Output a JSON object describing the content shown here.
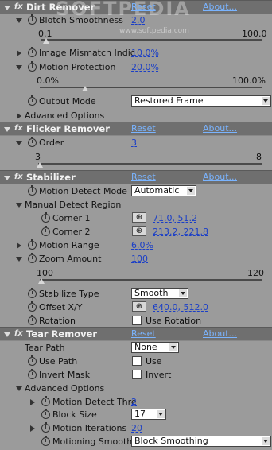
{
  "watermark": {
    "text": "SOFTPEDIA",
    "sub": "www.softpedia.com"
  },
  "fx": "fx",
  "dirt": {
    "title": "Dirt Remover",
    "reset": "Reset",
    "about": "About...",
    "blotch": {
      "label": "Blotch Smoothness",
      "value": "2.0",
      "min": "0.1",
      "max": "100.0",
      "level": 0.02
    },
    "mismatch": {
      "label": "Image Mismatch Indic",
      "value": "10.0%"
    },
    "motion": {
      "label": "Motion Protection",
      "value": "20.0%",
      "min": "0.0%",
      "max": "100.0%",
      "level": 0.2
    },
    "output": {
      "label": "Output Mode",
      "value": "Restored Frame"
    },
    "advanced": {
      "label": "Advanced Options"
    }
  },
  "flicker": {
    "title": "Flicker Remover",
    "reset": "Reset",
    "about": "About...",
    "order": {
      "label": "Order",
      "value": "3",
      "min": "3",
      "max": "8",
      "level": 0
    }
  },
  "stab": {
    "title": "Stabilizer",
    "reset": "Reset",
    "about": "About...",
    "detect_mode": {
      "label": "Motion Detect Mode",
      "value": "Automatic"
    },
    "region": {
      "label": "Manual Detect Region"
    },
    "corner1": {
      "label": "Corner 1",
      "value": "71.0, 51.2"
    },
    "corner2": {
      "label": "Corner 2",
      "value": "213.2, 221.8"
    },
    "range": {
      "label": "Motion Range",
      "value": "6.0%"
    },
    "zoom": {
      "label": "Zoom Amount",
      "value": "100",
      "min": "100",
      "max": "120",
      "level": 0
    },
    "type": {
      "label": "Stabilize Type",
      "value": "Smooth"
    },
    "offset": {
      "label": "Offset X/Y",
      "value": "640.0, 512.0"
    },
    "rotation": {
      "label": "Rotation",
      "check": "Use Rotation"
    }
  },
  "tear": {
    "title": "Tear Remover",
    "reset": "Reset",
    "about": "About...",
    "path": {
      "label": "Tear Path",
      "value": "None"
    },
    "usepath": {
      "label": "Use Path",
      "check": "Use"
    },
    "invert": {
      "label": "Invert Mask",
      "check": "Invert"
    },
    "advanced": {
      "label": "Advanced Options"
    },
    "thresh": {
      "label": "Motion Detect Thre",
      "value": "2"
    },
    "block": {
      "label": "Block Size",
      "value": "17"
    },
    "iter": {
      "label": "Motion Iterations",
      "value": "20"
    },
    "smooth": {
      "label": "Motioning Smoothing",
      "value": "Block Smoothing"
    }
  }
}
